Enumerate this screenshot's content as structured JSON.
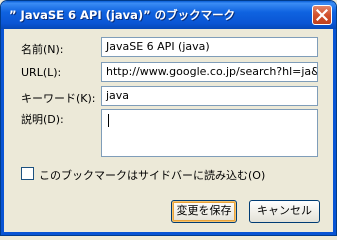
{
  "window": {
    "title": "” JavaSE 6 API (java)” のブックマーク",
    "close_icon": "close-icon"
  },
  "form": {
    "name_label": "名前(N):",
    "name_value": "JavaSE 6 API (java)",
    "url_label": "URL(L):",
    "url_value": "http://www.google.co.jp/search?hl=ja&q=sit",
    "keyword_label": "キーワード(K):",
    "keyword_value": "java",
    "description_label": "説明(D):",
    "description_value": ""
  },
  "sidebar_option": {
    "label": "このブックマークはサイドバーに読み込む(O)",
    "checked": false
  },
  "buttons": {
    "save_label": "変更を保存",
    "cancel_label": "キャンセル"
  },
  "colors": {
    "titlebar": "#0a55d4",
    "close_button": "#d2512d",
    "dialog_background": "#ece9d8"
  }
}
